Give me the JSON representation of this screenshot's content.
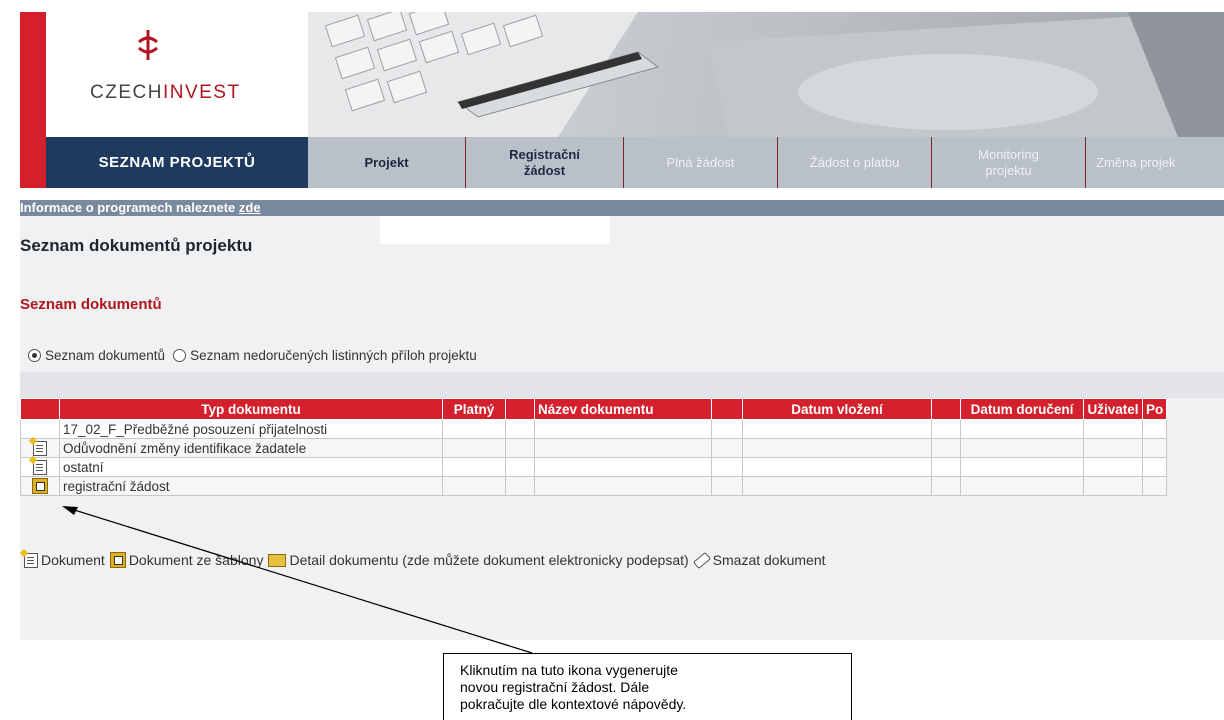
{
  "logo": {
    "text_a": "CZECH",
    "text_b": "INVEST"
  },
  "nav": {
    "main": "SEZNAM PROJEKTŮ",
    "tabs": [
      {
        "label": "Projekt",
        "active": true
      },
      {
        "label": "Registrační\nžádost",
        "active": true
      },
      {
        "label": "Plná žádost",
        "active": false
      },
      {
        "label": "Žádost o platbu",
        "active": false
      },
      {
        "label": "Monitoring\nprojektu",
        "active": false
      },
      {
        "label": "Změna projek",
        "active": false
      }
    ]
  },
  "info": {
    "text": "Informace o programech naleznete ",
    "link": "zde"
  },
  "page_title": "Seznam dokumentů projektu",
  "section_title": "Seznam dokumentů",
  "radios": {
    "option1": "Seznam dokumentů",
    "option2": "Seznam nedoručených listinných příloh projektu",
    "selected": "option1"
  },
  "table": {
    "headers": [
      "Typ dokumentu",
      "Platný",
      "Název dokumentu",
      "Datum vložení",
      "Datum doručení",
      "Uživatel",
      "Po"
    ],
    "rows": [
      {
        "icon": "",
        "type": "17_02_F_Předběžné posouzení přijatelnosti"
      },
      {
        "icon": "new-document-icon",
        "type": "Odůvodnění změny identifikace žadatele"
      },
      {
        "icon": "new-document-icon",
        "type": "ostatní"
      },
      {
        "icon": "template-document-icon",
        "type": "registrační žádost"
      }
    ]
  },
  "legend": {
    "document": "Dokument",
    "template": "Dokument ze šablony",
    "detail": "Detail dokumentu (zde můžete dokument elektronicky podepsat)",
    "delete": "Smazat dokument"
  },
  "callout": {
    "text": "Kliknutím na tuto ikona vygenerujte\nnovou registrační žádost. Dále\npokračujte dle kontextové nápovědy."
  },
  "colors": {
    "brand_red": "#d4202c",
    "nav_dark": "#1e3a5e",
    "nav_gray": "#b9c0c8"
  }
}
